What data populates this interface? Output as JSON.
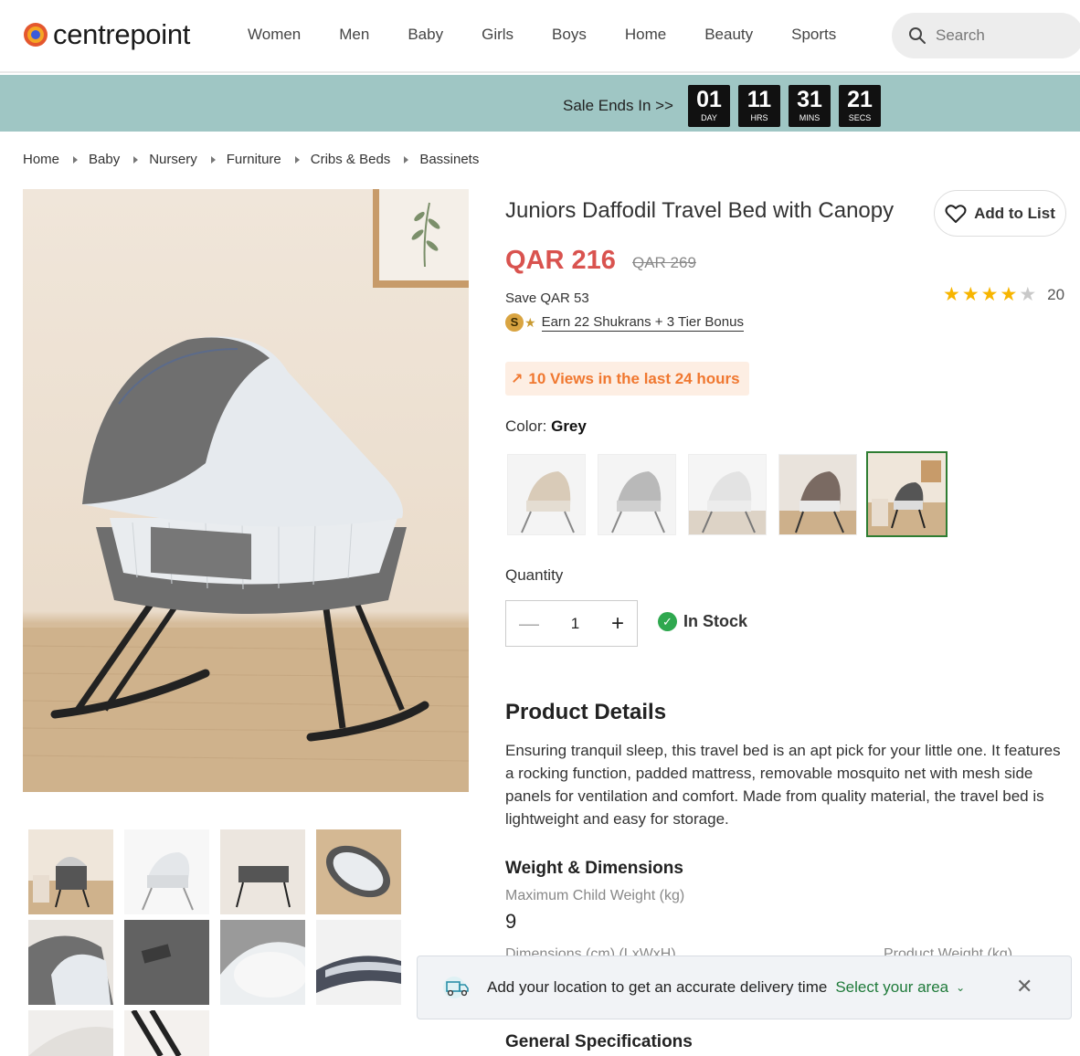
{
  "header": {
    "logo_text": "centrepoint",
    "nav": [
      "Women",
      "Men",
      "Baby",
      "Girls",
      "Boys",
      "Home",
      "Beauty",
      "Sports"
    ],
    "search_placeholder": "Search"
  },
  "sale": {
    "label": "Sale Ends In >>",
    "timers": [
      {
        "value": "01",
        "unit": "DAY"
      },
      {
        "value": "11",
        "unit": "HRS"
      },
      {
        "value": "31",
        "unit": "MINS"
      },
      {
        "value": "21",
        "unit": "SECS"
      }
    ]
  },
  "breadcrumb": [
    "Home",
    "Baby",
    "Nursery",
    "Furniture",
    "Cribs & Beds",
    "Bassinets"
  ],
  "product": {
    "title": "Juniors Daffodil Travel Bed with Canopy",
    "add_to_list": "Add to List",
    "price": "QAR 216",
    "old_price": "QAR 269",
    "save": "Save QAR 53",
    "rating": 4,
    "rating_max": 5,
    "rating_count": "20",
    "shukrans_coin": "S",
    "shukrans_text": "Earn 22 Shukrans + 3  Tier Bonus",
    "views": "10 Views in the last 24 hours",
    "color_label": "Color:",
    "color_value": "Grey",
    "quantity_label": "Quantity",
    "quantity_value": "1",
    "stock": "In Stock",
    "details_heading": "Product Details",
    "description": "Ensuring tranquil sleep, this travel bed is an apt pick for your little one. It features a rocking function, padded mattress, removable mosquito net with mesh side panels for ventilation and comfort. Made from quality material, the travel bed is lightweight and easy for storage.",
    "weight_heading": "Weight & Dimensions",
    "max_weight_label": "Maximum Child Weight (kg)",
    "max_weight_value": "9",
    "dimensions_label": "Dimensions (cm) (LxWxH)",
    "product_weight_label": "Product Weight (kg)",
    "general_heading": "General Specifications"
  },
  "toast": {
    "message": "Add your location to get an accurate delivery time",
    "link": "Select your area",
    "close": "✕"
  },
  "colors": {
    "accent_red": "#d9534f",
    "sale_banner": "#9fc6c4",
    "stock_green": "#2fa84f",
    "link_green": "#1f7a3a",
    "views_orange": "#f07830"
  }
}
